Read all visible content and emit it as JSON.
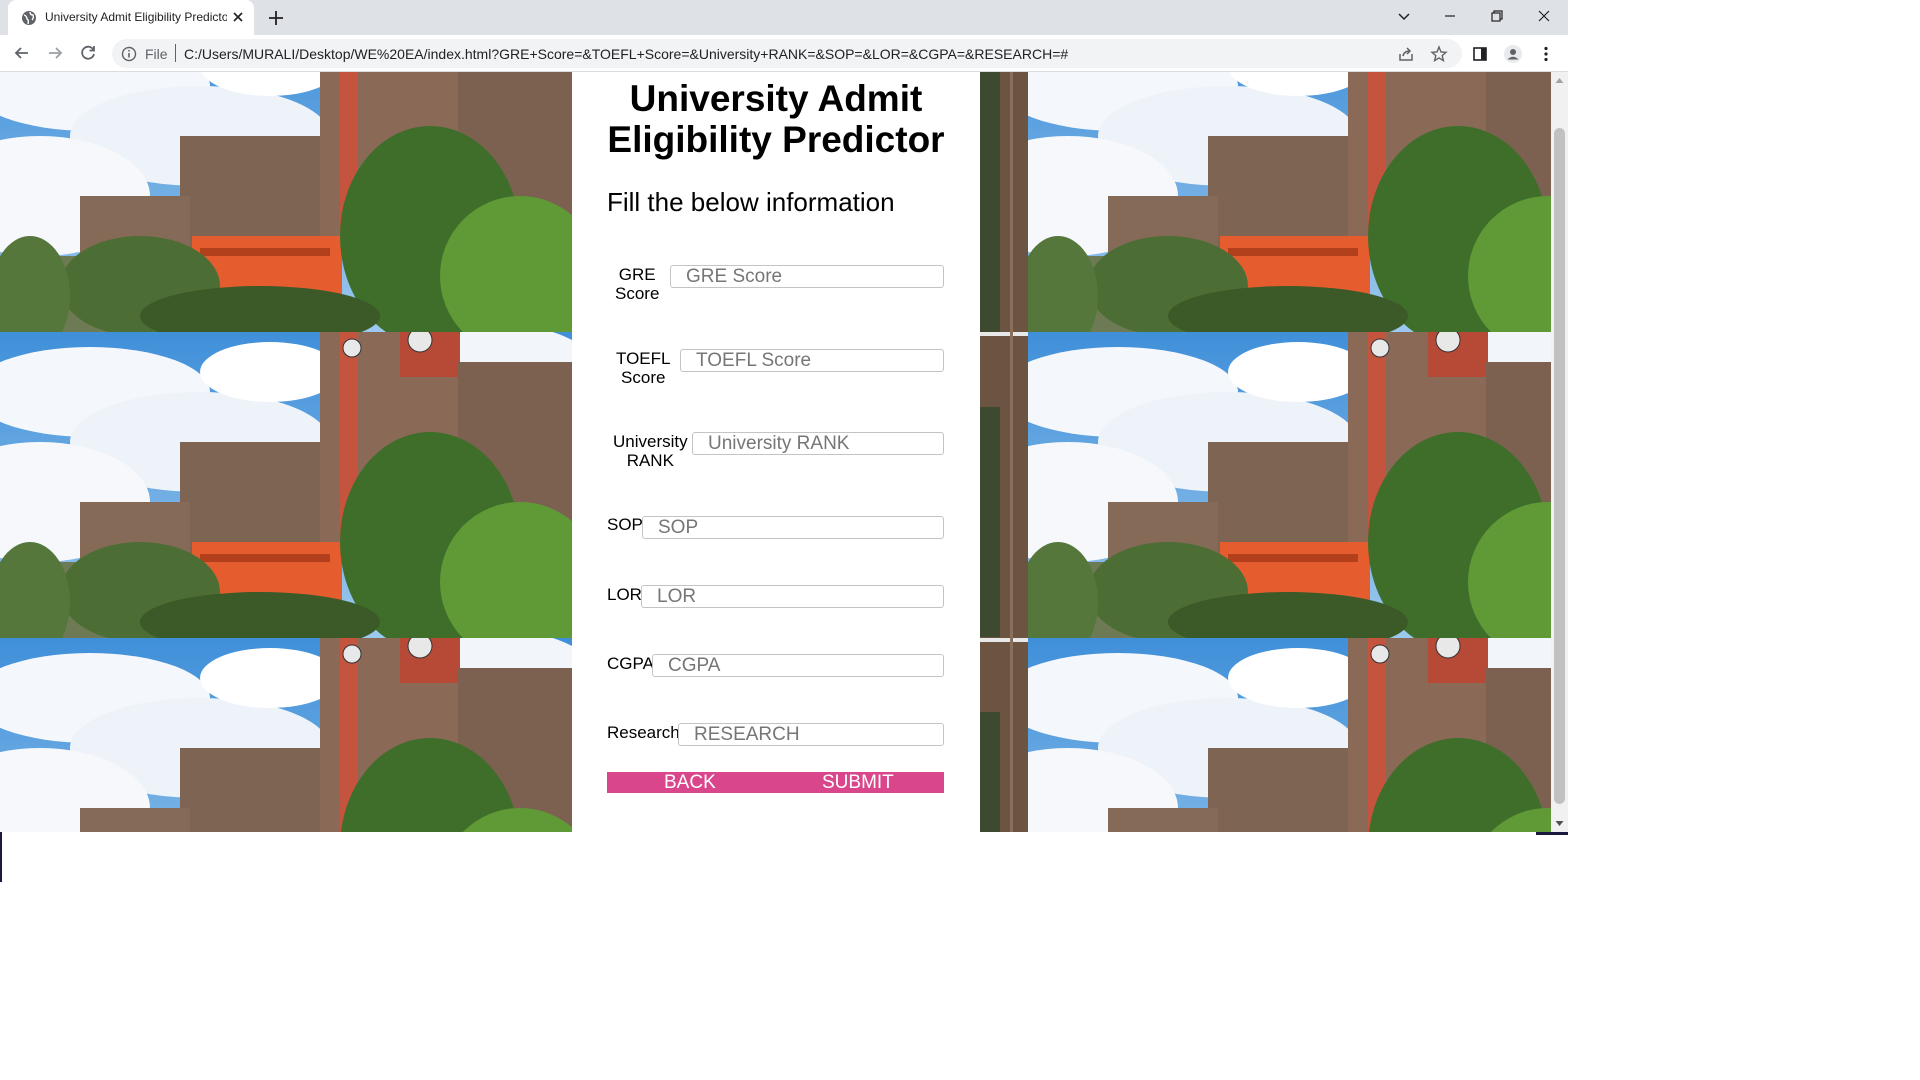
{
  "browser": {
    "tab_title": "University Admit Eligibility Predictor",
    "omnibox_scheme": "File",
    "url": "C:/Users/MURALI/Desktop/WE%20EA/index.html?GRE+Score=&TOEFL+Score=&University+RANK=&SOP=&LOR=&CGPA=&RESEARCH=#"
  },
  "page": {
    "heading_line1": "University Admit",
    "heading_line2": "Eligibility Predictor",
    "subheading": "Fill the below information",
    "fields": [
      {
        "label_line1": "GRE",
        "label_line2": "Score",
        "placeholder": "GRE Score",
        "value": ""
      },
      {
        "label_line1": "TOEFL",
        "label_line2": "Score",
        "placeholder": "TOEFL Score",
        "value": ""
      },
      {
        "label_line1": "University",
        "label_line2": "RANK",
        "placeholder": "University RANK",
        "value": ""
      },
      {
        "label_line1": "SOP",
        "placeholder": "SOP",
        "value": ""
      },
      {
        "label_line1": "LOR",
        "placeholder": "LOR",
        "value": ""
      },
      {
        "label_line1": "CGPA",
        "placeholder": "CGPA",
        "value": ""
      },
      {
        "label_line1": "Research",
        "placeholder": "RESEARCH",
        "value": ""
      }
    ],
    "back_label": "BACK",
    "submit_label": "SUBMIT"
  },
  "colors": {
    "button_bar": "#d9468c",
    "tab_strip": "#dee1e6",
    "omnibox": "#f1f3f4"
  },
  "icons": [
    "globe-icon",
    "close-icon",
    "plus-icon",
    "chevron-down-icon",
    "minimize-icon",
    "restore-icon",
    "window-close-icon",
    "back-arrow-icon",
    "forward-arrow-icon",
    "reload-icon",
    "info-icon",
    "share-icon",
    "star-icon",
    "side-panel-icon",
    "profile-icon",
    "kebab-menu-icon"
  ]
}
